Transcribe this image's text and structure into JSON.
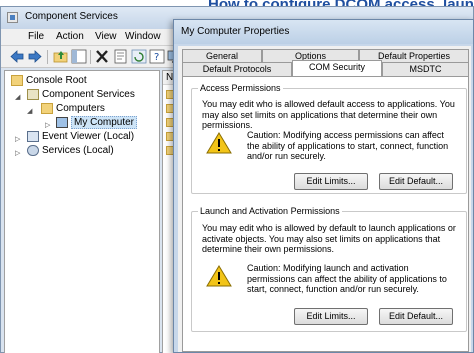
{
  "background_page": {
    "headline": "How to configure DCOM access, launch and"
  },
  "main_window": {
    "title": "Component Services",
    "menu": [
      "File",
      "Action",
      "View",
      "Window"
    ],
    "toolbar_icons": [
      "back-arrow-icon",
      "forward-arrow-icon",
      "up-folder-icon",
      "show-tree-icon",
      "delete-icon",
      "properties-icon",
      "refresh-icon",
      "help-icon",
      "monitor-icon"
    ],
    "tree": {
      "root": "Console Root",
      "component_services": "Component Services",
      "computers": "Computers",
      "my_computer": "My Computer",
      "event_viewer": "Event Viewer (Local)",
      "services": "Services (Local)"
    },
    "list_header": "N"
  },
  "dialog": {
    "title": "My Computer Properties",
    "tabs_row1": [
      "General",
      "Options",
      "Default Properties"
    ],
    "tabs_row2": [
      "Default Protocols",
      "COM Security",
      "MSDTC"
    ],
    "active_tab": "COM Security",
    "access": {
      "title": "Access Permissions",
      "description": "You may edit who is allowed default access to applications. You may also set limits on applications that determine their own permissions.",
      "caution": "Caution: Modifying access permissions can affect the ability of applications to start, connect, function and/or run securely.",
      "edit_limits": "Edit Limits...",
      "edit_default": "Edit Default..."
    },
    "launch": {
      "title": "Launch and Activation Permissions",
      "description": "You may edit who is allowed by default to launch applications or activate objects. You may also set limits on applications that determine their own permissions.",
      "caution": "Caution: Modifying launch and activation permissions can affect the ability of applications to start, connect, function and/or run securely.",
      "edit_limits": "Edit Limits...",
      "edit_default": "Edit Default..."
    }
  },
  "colors": {
    "selection": "#cde4f7",
    "titlebar": "#c5d5e8",
    "link": "#1f4fa0",
    "warning": "#f2c418"
  }
}
